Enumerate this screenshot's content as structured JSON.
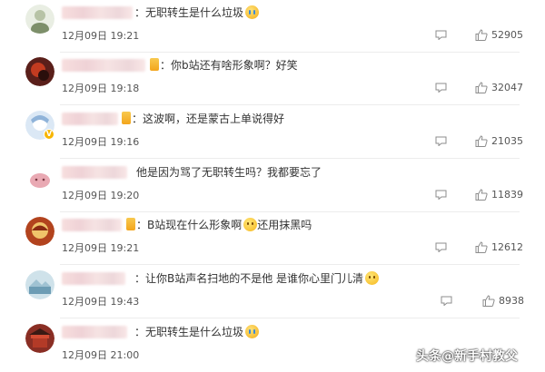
{
  "comments": [
    {
      "text": "：无职转生是什么垃圾",
      "time": "12月09日 19:21",
      "likes": "52905",
      "emoji": "cry-emoji",
      "vip": false,
      "avatar_colors": [
        "#e9eee3",
        "#7d8f6a"
      ]
    },
    {
      "text": "：你b站还有啥形象啊？好笑",
      "time": "12月09日 19:18",
      "likes": "32047",
      "emoji": "",
      "vip": true,
      "avatar_colors": [
        "#5a1f1a",
        "#c23b20"
      ]
    },
    {
      "text": "：这波啊，还是蒙古上单说得好",
      "time": "12月09日 19:16",
      "likes": "21035",
      "emoji": "",
      "vip": true,
      "avatar_colors": [
        "#dbe8f5",
        "#8fb3d9"
      ]
    },
    {
      "text": "他是因为骂了无职转生吗？我都要忘了",
      "time": "12月09日 19:20",
      "likes": "11839",
      "emoji": "",
      "vip": false,
      "avatar_colors": [
        "#f6dede",
        "#e9a9b3"
      ]
    },
    {
      "text": "：B站现在什么形象啊",
      "text_after": "还用抹黑吗",
      "time": "12月09日 19:21",
      "likes": "12612",
      "emoji": "sweat-emoji",
      "vip": true,
      "avatar_colors": [
        "#b2431e",
        "#f0c36a"
      ]
    },
    {
      "text": "：让你B站声名扫地的不是他 是谁你心里门儿清",
      "time": "12月09日 19:43",
      "likes": "8938",
      "emoji": "smile-emoji",
      "vip": false,
      "avatar_colors": [
        "#cfe2ea",
        "#6c9cb4"
      ]
    },
    {
      "text": "：无职转生是什么垃圾",
      "time": "12月09日 21:00",
      "likes": "",
      "emoji": "cry-emoji",
      "vip": false,
      "avatar_colors": [
        "#8a2e24",
        "#d24c33"
      ]
    }
  ],
  "icons": {
    "reply": "reply-icon",
    "like": "thumbs-up-icon"
  },
  "watermark": "头条@新手村教父",
  "colors": {
    "text": "#333333",
    "meta": "#555555",
    "icon": "#8c8c8c",
    "vip": "#f7b500"
  }
}
